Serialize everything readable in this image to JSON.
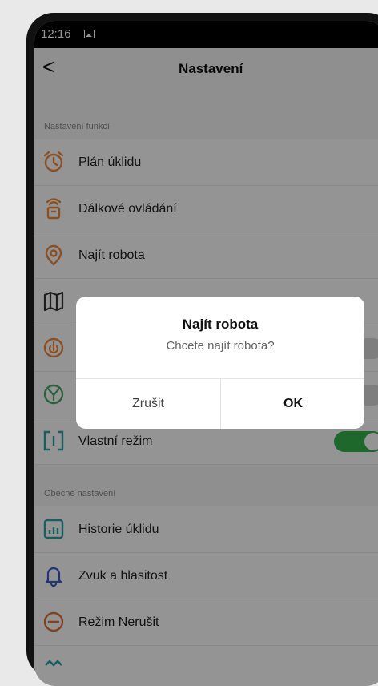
{
  "status": {
    "time": "12:16"
  },
  "header": {
    "back": "<",
    "title": "Nastavení"
  },
  "section_features": "Nastavení funkcí",
  "features": [
    {
      "label": "Plán úklidu",
      "icon": "alarm-clock-icon"
    },
    {
      "label": "Dálkové ovládání",
      "icon": "remote-control-icon"
    },
    {
      "label": "Najít robota",
      "icon": "location-pin-icon"
    },
    {
      "label": "",
      "icon": "map-icon"
    },
    {
      "label": "",
      "icon": "carpet-boost-icon",
      "toggle": false
    },
    {
      "label": "",
      "icon": "filter-icon",
      "toggle": false
    },
    {
      "label": "Vlastní režim",
      "icon": "custom-mode-icon",
      "toggle": true
    }
  ],
  "section_general": "Obecné nastavení",
  "general": [
    {
      "label": "Historie úklidu",
      "icon": "history-chart-icon"
    },
    {
      "label": "Zvuk a hlasitost",
      "icon": "bell-icon"
    },
    {
      "label": "Režim Nerušit",
      "icon": "do-not-disturb-icon"
    }
  ],
  "dialog": {
    "title": "Najít robota",
    "message": "Chcete najít robota?",
    "cancel": "Zrušit",
    "ok": "OK"
  },
  "colors": {
    "accent_orange": "#f08a3c",
    "toggle_on": "#34b34a",
    "toggle_off": "#d9d9d9"
  }
}
